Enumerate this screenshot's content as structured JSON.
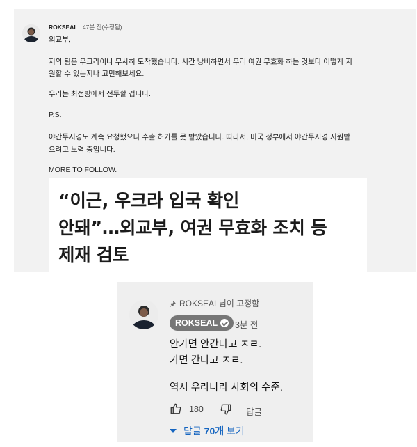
{
  "top_comment": {
    "author": "ROKSEAL",
    "time": "47분 전(수정됨)",
    "lines": [
      "외교부,",
      "저의 팀은 우크라이나 무사히 도착했습니다. 시간 낭비하면서 우리 여권 무효화 하는 것보다 어떻게 지",
      "원할 수 있는지나 고민해보세요.",
      "우리는 최전방에서 전투할 겁니다.",
      "P.S.",
      "야간투시경도 계속 요청했으나 수출 허가를 못 받았습니다. 따라서, 미국 정부에서 야간투시경 지원받",
      "으려고 노력 중입니다.",
      "MORE TO FOLLOW."
    ],
    "news_headline": [
      "“이근, 우크라 입국 확인",
      "안돼”…외교부, 여권 무효화 조치 등",
      "제재 검토"
    ]
  },
  "pinned_comment": {
    "pinned_label": "ROKSEAL님이 고정함",
    "author": "ROKSEAL",
    "time": "3분 전",
    "lines": [
      "안가면 안간다고 ㅈㄹ.",
      "가면 간다고 ㅈㄹ.",
      "역시 우라나라 사회의 수준."
    ],
    "likes": "180",
    "reply_label": "답글",
    "view_replies_prefix": "답글 ",
    "view_replies_count": "70개",
    "view_replies_suffix": " 보기",
    "accent_color": "#1565c0"
  }
}
